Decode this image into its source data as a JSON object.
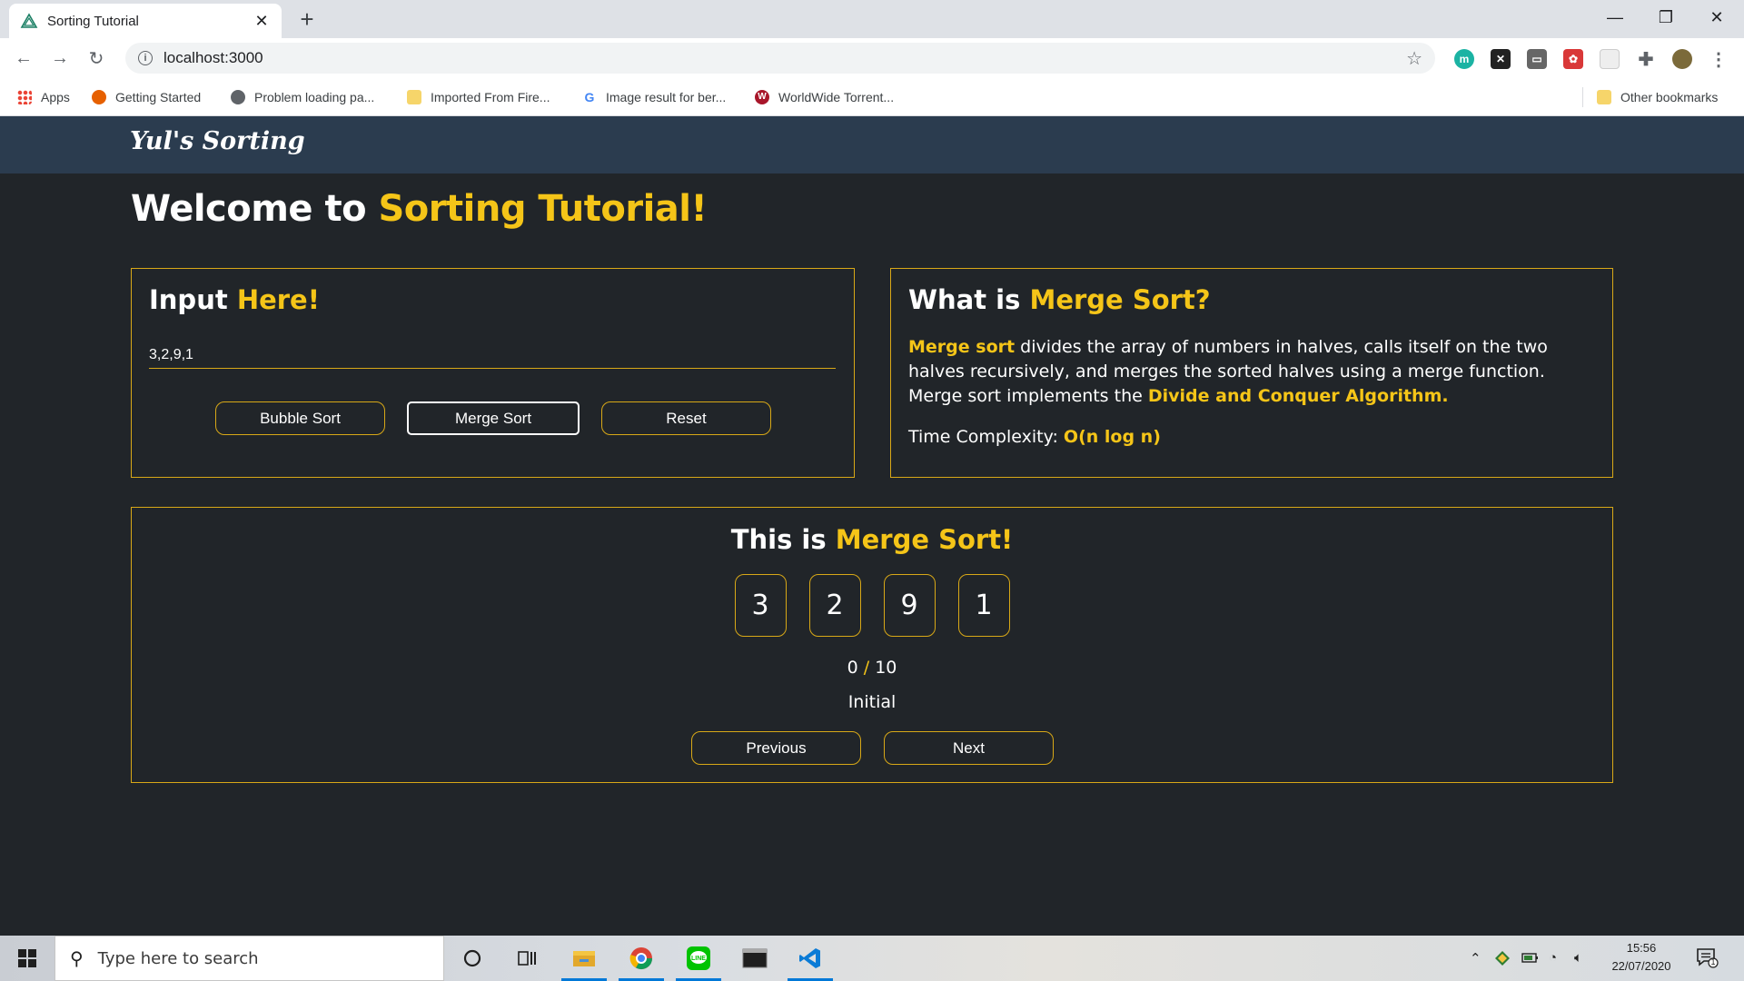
{
  "browser": {
    "tab_title": "Sorting Tutorial",
    "url": "localhost:3000",
    "bookmarks": [
      {
        "label": "Apps"
      },
      {
        "label": "Getting Started"
      },
      {
        "label": "Problem loading pa..."
      },
      {
        "label": "Imported From Fire..."
      },
      {
        "label": "Image result for ber..."
      },
      {
        "label": "WorldWide Torrent..."
      }
    ],
    "other_bookmarks": "Other bookmarks"
  },
  "navbar": {
    "brand": "Yul's Sorting"
  },
  "welcome": {
    "prefix": "Welcome to ",
    "highlight": "Sorting Tutorial!"
  },
  "input_card": {
    "title_prefix": "Input ",
    "title_highlight": "Here!",
    "input_value": "3,2,9,1",
    "buttons": {
      "bubble": "Bubble Sort",
      "merge": "Merge Sort",
      "reset": "Reset"
    }
  },
  "info_card": {
    "title_prefix": "What is ",
    "title_highlight": "Merge Sort?",
    "lead": "Merge sort",
    "body": " divides the array of numbers in halves, calls itself on the two halves recursively, and merges the sorted halves using a merge function. Merge sort implements the ",
    "algo": "Divide and Conquer Algorithm.",
    "complexity_label": "Time Complexity: ",
    "complexity_value": "O(n log n)"
  },
  "viz_card": {
    "title_prefix": "This is ",
    "title_highlight": "Merge Sort!",
    "numbers": [
      "3",
      "2",
      "9",
      "1"
    ],
    "step_current": "0",
    "step_sep": " / ",
    "step_total": "10",
    "stage": "Initial",
    "prev_label": "Previous",
    "next_label": "Next"
  },
  "taskbar": {
    "search_placeholder": "Type here to search",
    "time": "15:56",
    "date": "22/07/2020",
    "notifications": "1"
  },
  "colors": {
    "accent": "#f5c518",
    "background": "#212529",
    "navbar": "#2b3c4f",
    "border": "#d8a817"
  }
}
